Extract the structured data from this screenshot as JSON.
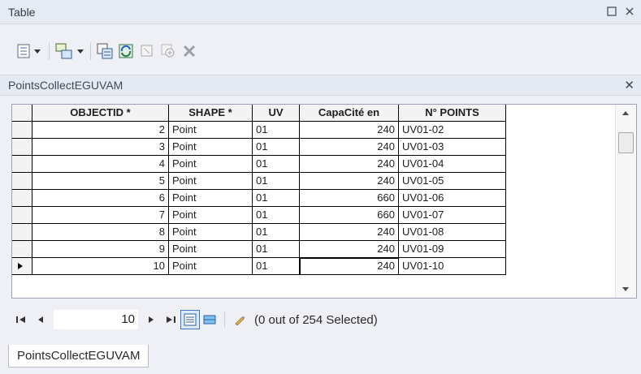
{
  "window": {
    "title": "Table"
  },
  "toolbar": {
    "icons": [
      "table-options-icon",
      "related-tables-icon",
      "select-by-attributes-icon",
      "switch-selection-icon",
      "clear-selection-icon",
      "zoom-to-selected-icon",
      "delete-selected-icon"
    ]
  },
  "table": {
    "name": "PointsCollectEGUVAM",
    "columns": [
      "OBJECTID *",
      "SHAPE *",
      "UV",
      "CapaCité en",
      "N° POINTS"
    ],
    "rows": [
      [
        "2",
        "Point",
        "01",
        "240",
        "UV01-02"
      ],
      [
        "3",
        "Point",
        "01",
        "240",
        "UV01-03"
      ],
      [
        "4",
        "Point",
        "01",
        "240",
        "UV01-04"
      ],
      [
        "5",
        "Point",
        "01",
        "240",
        "UV01-05"
      ],
      [
        "6",
        "Point",
        "01",
        "660",
        "UV01-06"
      ],
      [
        "7",
        "Point",
        "01",
        "660",
        "UV01-07"
      ],
      [
        "8",
        "Point",
        "01",
        "240",
        "UV01-08"
      ],
      [
        "9",
        "Point",
        "01",
        "240",
        "UV01-09"
      ],
      [
        "10",
        "Point",
        "01",
        "240",
        "UV01-10"
      ]
    ],
    "current_row_index": 8
  },
  "navigation": {
    "current_record": "10",
    "selection_status": "(0 out of 254 Selected)"
  },
  "tabs": [
    "PointsCollectEGUVAM"
  ],
  "colors": {
    "titlebar": "#e6ebf3",
    "grid_border": "#000000",
    "active_view": "#3b79c8"
  }
}
